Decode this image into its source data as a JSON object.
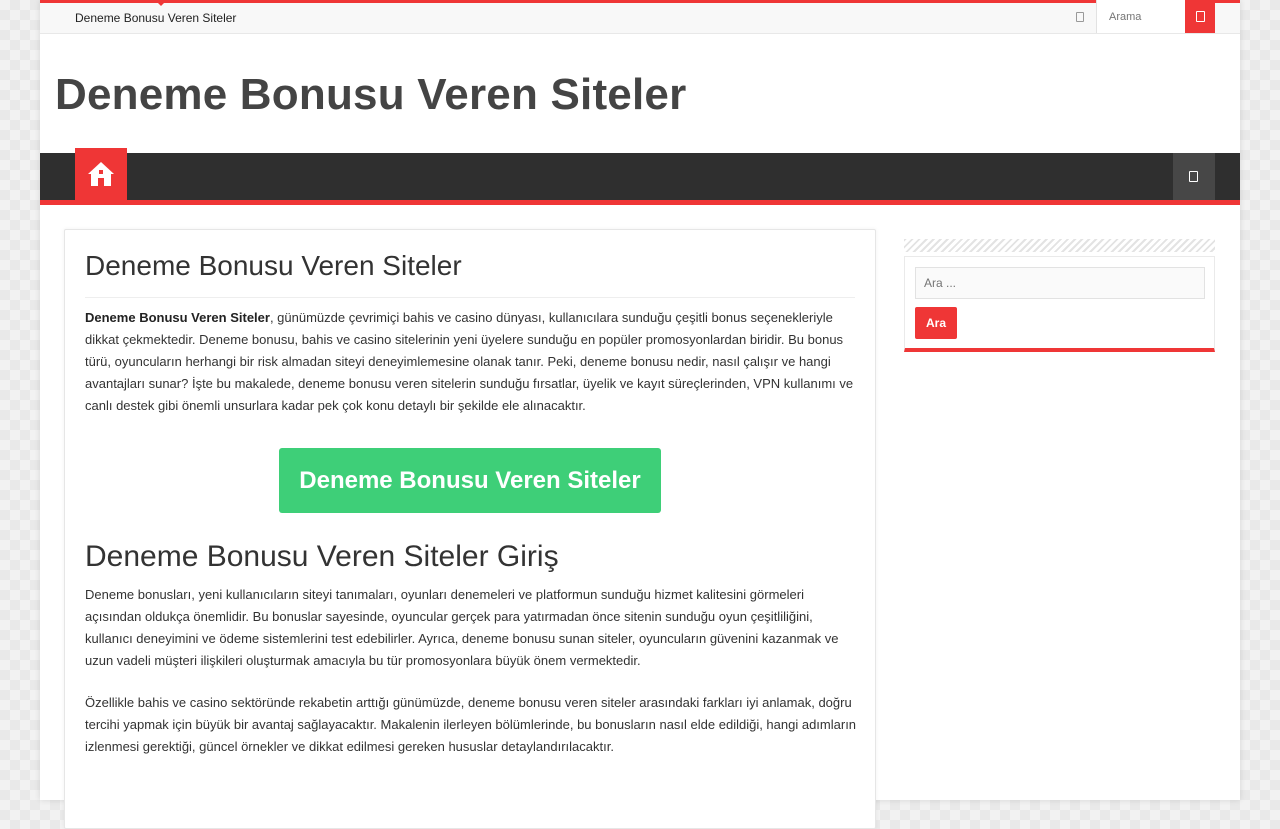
{
  "topbar": {
    "menu_item": "Deneme Bonusu Veren Siteler",
    "search_placeholder": "Arama"
  },
  "header": {
    "site_title": "Deneme Bonusu Veren Siteler"
  },
  "nav": {
    "home_icon": "home-icon",
    "menu_icon": "mobile-menu-icon"
  },
  "post": {
    "title": "Deneme Bonusu Veren Siteler",
    "intro_bold": "Deneme Bonusu Veren Siteler",
    "intro_rest": ", günümüzde çevrimiçi bahis ve casino dünyası, kullanıcılara sunduğu çeşitli bonus seçenekleriyle dikkat çekmektedir. Deneme bonusu, bahis ve casino sitelerinin yeni üyelere sunduğu en popüler promosyonlardan biridir. Bu bonus türü, oyuncuların herhangi bir risk almadan siteyi deneyimlemesine olanak tanır. Peki, deneme bonusu nedir, nasıl çalışır ve hangi avantajları sunar? İşte bu makalede, deneme bonusu veren sitelerin sunduğu fırsatlar, üyelik ve kayıt süreçlerinden, VPN kullanımı ve canlı destek gibi önemli unsurlara kadar pek çok konu detaylı bir şekilde ele alınacaktır.",
    "cta_label": "Deneme Bonusu Veren Siteler",
    "h2": "Deneme Bonusu Veren Siteler Giriş",
    "para2": "Deneme bonusları, yeni kullanıcıların siteyi tanımaları, oyunları denemeleri ve platformun sunduğu hizmet kalitesini görmeleri açısından oldukça önemlidir. Bu bonuslar sayesinde, oyuncular gerçek para yatırmadan önce sitenin sunduğu oyun çeşitliliğini, kullanıcı deneyimini ve ödeme sistemlerini test edebilirler. Ayrıca, deneme bonusu sunan siteler, oyuncuların güvenini kazanmak ve uzun vadeli müşteri ilişkileri oluşturmak amacıyla bu tür promosyonlara büyük önem vermektedir.",
    "para3": "Özellikle bahis ve casino sektöründe rekabetin arttığı günümüzde, deneme bonusu veren siteler arasındaki farkları iyi anlamak, doğru tercihi yapmak için büyük bir avantaj sağlayacaktır. Makalenin ilerleyen bölümlerinde, bu bonusların nasıl elde edildiği, hangi adımların izlenmesi gerektiği, güncel örnekler ve dikkat edilmesi gereken hususlar detaylandırılacaktır."
  },
  "sidebar": {
    "search_placeholder": "Ara ...",
    "search_button": "Ara"
  },
  "colors": {
    "accent": "#ef3636",
    "cta": "#3ecf78",
    "nav_bg": "#2f2f2f"
  }
}
